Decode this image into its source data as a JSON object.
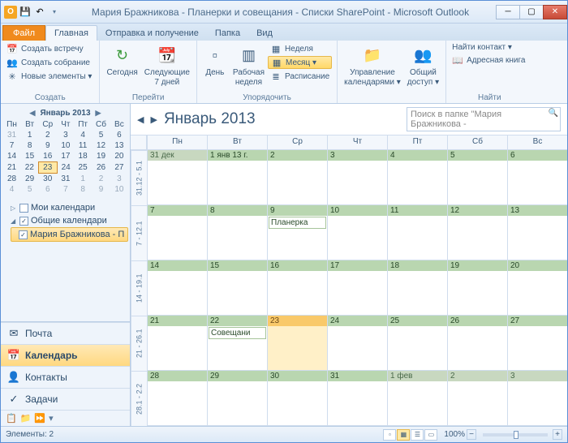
{
  "titlebar": {
    "title": "Мария Бражникова - Планерки и совещания - Списки SharePoint - Microsoft Outlook"
  },
  "ribbon": {
    "file": "Файл",
    "tabs": [
      "Главная",
      "Отправка и получение",
      "Папка",
      "Вид"
    ],
    "active_tab": 0,
    "groups": {
      "create": {
        "label": "Создать",
        "new_meeting": "Создать встречу",
        "new_gathering": "Создать собрание",
        "new_items": "Новые элементы ▾"
      },
      "goto": {
        "label": "Перейти",
        "today": "Сегодня",
        "next7": "Следующие\n7 дней"
      },
      "arrange": {
        "label": "Упорядочить",
        "day": "День",
        "workweek": "Рабочая\nнеделя",
        "week": "Неделя",
        "month": "Месяц ▾",
        "schedule": "Расписание"
      },
      "manage": {
        "label": "",
        "manage_cals": "Управление\nкалендарями ▾",
        "share": "Общий\nдоступ ▾"
      },
      "find": {
        "label": "Найти",
        "find_contact": "Найти контакт ▾",
        "address_book": "Адресная книга"
      }
    }
  },
  "minical": {
    "month": "Январь 2013",
    "dow": [
      "Пн",
      "Вт",
      "Ср",
      "Чт",
      "Пт",
      "Сб",
      "Вс"
    ],
    "rows": [
      [
        "31",
        "1",
        "2",
        "3",
        "4",
        "5",
        "6"
      ],
      [
        "7",
        "8",
        "9",
        "10",
        "11",
        "12",
        "13"
      ],
      [
        "14",
        "15",
        "16",
        "17",
        "18",
        "19",
        "20"
      ],
      [
        "21",
        "22",
        "23",
        "24",
        "25",
        "26",
        "27"
      ],
      [
        "28",
        "29",
        "30",
        "31",
        "1",
        "2",
        "3"
      ],
      [
        "4",
        "5",
        "6",
        "7",
        "8",
        "9",
        "10"
      ]
    ],
    "other_month_pre": 1,
    "other_month_post_start": [
      4,
      4
    ],
    "today": [
      3,
      2
    ]
  },
  "navtree": {
    "my_cals": "Мои календари",
    "shared_cals": "Общие календари",
    "selected_cal": "Мария Бражникова - П"
  },
  "navbuttons": {
    "mail": "Почта",
    "calendar": "Календарь",
    "contacts": "Контакты",
    "tasks": "Задачи"
  },
  "calendar": {
    "title": "Январь 2013",
    "search_placeholder": "Поиск в папке \"Мария Бражникова - ",
    "dow": [
      "Пн",
      "Вт",
      "Ср",
      "Чт",
      "Пт",
      "Сб",
      "Вс"
    ],
    "week_labels": [
      "31.12 - 5.1",
      "7 - 12.1",
      "14 - 19.1",
      "21 - 26.1",
      "28.1 - 2.2"
    ],
    "weeks": [
      [
        {
          "label": "31 дек",
          "out": true
        },
        {
          "label": "1 янв 13 г."
        },
        {
          "label": "2"
        },
        {
          "label": "3"
        },
        {
          "label": "4"
        },
        {
          "label": "5"
        },
        {
          "label": "6"
        }
      ],
      [
        {
          "label": "7"
        },
        {
          "label": "8"
        },
        {
          "label": "9",
          "events": [
            "Планерка"
          ]
        },
        {
          "label": "10"
        },
        {
          "label": "11"
        },
        {
          "label": "12"
        },
        {
          "label": "13"
        }
      ],
      [
        {
          "label": "14"
        },
        {
          "label": "15"
        },
        {
          "label": "16"
        },
        {
          "label": "17"
        },
        {
          "label": "18"
        },
        {
          "label": "19"
        },
        {
          "label": "20"
        }
      ],
      [
        {
          "label": "21"
        },
        {
          "label": "22",
          "events": [
            "Совещани"
          ]
        },
        {
          "label": "23",
          "today": true
        },
        {
          "label": "24"
        },
        {
          "label": "25"
        },
        {
          "label": "26"
        },
        {
          "label": "27"
        }
      ],
      [
        {
          "label": "28"
        },
        {
          "label": "29"
        },
        {
          "label": "30"
        },
        {
          "label": "31"
        },
        {
          "label": "1 фев",
          "out": true
        },
        {
          "label": "2",
          "out": true
        },
        {
          "label": "3",
          "out": true
        }
      ]
    ]
  },
  "statusbar": {
    "items": "Элементы: 2",
    "zoom": "100%"
  }
}
